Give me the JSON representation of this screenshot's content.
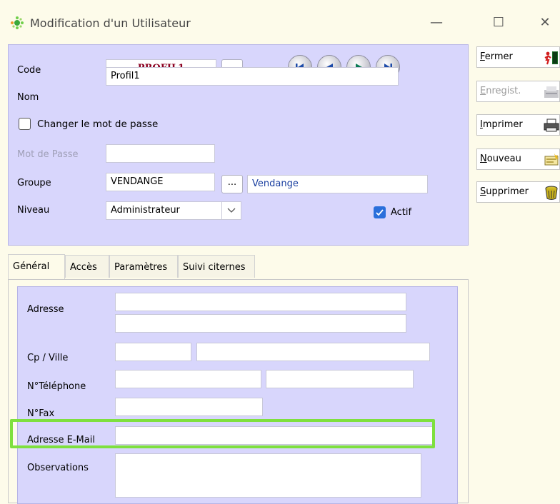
{
  "window": {
    "title": "Modification d'un Utilisateur",
    "minimize": "—",
    "maximize": "☐",
    "close": "✕"
  },
  "form": {
    "code_label": "Code",
    "code_value": "PROFIL1",
    "code_btn": "...",
    "nom_label": "Nom",
    "nom_value": "Profil1",
    "change_pwd_label": "Changer le mot de passe",
    "change_pwd_checked": false,
    "mdp_label": "Mot de Passe",
    "mdp_value": "",
    "groupe_label": "Groupe",
    "groupe_code": "VENDANGE",
    "groupe_btn": "...",
    "groupe_name": "Vendange",
    "niveau_label": "Niveau",
    "niveau_value": "Administrateur",
    "actif_label": "Actif",
    "actif_checked": true
  },
  "sidebar": {
    "fermer": {
      "key": "F",
      "rest": "ermer"
    },
    "enregist": {
      "key": "E",
      "rest": "nregist."
    },
    "imprimer": {
      "key": "I",
      "rest": "mprimer"
    },
    "nouveau": {
      "key": "N",
      "rest": "ouveau"
    },
    "supprimer": {
      "key": "S",
      "rest": "upprimer"
    }
  },
  "tabs": [
    "Général",
    "Accès",
    "Paramètres",
    "Suivi citernes"
  ],
  "general": {
    "adresse_label": "Adresse",
    "adresse1": "",
    "adresse2": "",
    "cpville_label": "Cp / Ville",
    "cp": "",
    "ville": "",
    "tel_label": "N°Téléphone",
    "tel1": "",
    "tel2": "",
    "fax_label": "N°Fax",
    "fax": "",
    "email_label": "Adresse E-Mail",
    "email": "",
    "obs_label": "Observations",
    "obs": ""
  },
  "colors": {
    "panel": "#d8d6fc",
    "accent_highlight": "#7ee03e",
    "code_text": "#8b0020",
    "group_name_text": "#1a3fa0",
    "check_blue": "#2a6fdb"
  }
}
